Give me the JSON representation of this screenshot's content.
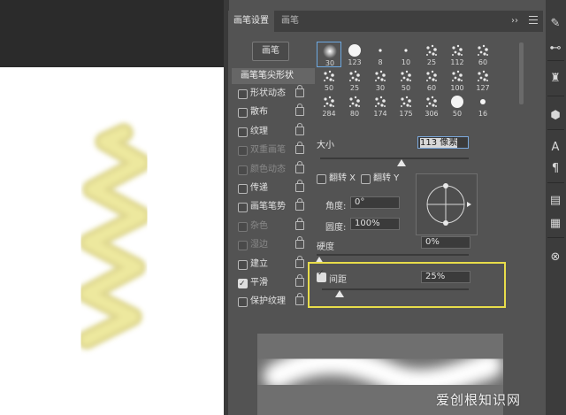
{
  "panel": {
    "tabs": [
      "画笔设置",
      "画笔"
    ],
    "collapse_label": "››",
    "brushes_button": "画笔",
    "tip_shape_label": "画笔笔尖形状",
    "options": [
      {
        "label": "形状动态",
        "checked": false,
        "disabled": false
      },
      {
        "label": "散布",
        "checked": false,
        "disabled": false
      },
      {
        "label": "纹理",
        "checked": false,
        "disabled": false
      },
      {
        "label": "双重画笔",
        "checked": false,
        "disabled": true
      },
      {
        "label": "颜色动态",
        "checked": false,
        "disabled": true
      },
      {
        "label": "传递",
        "checked": false,
        "disabled": false
      },
      {
        "label": "画笔笔势",
        "checked": false,
        "disabled": false
      },
      {
        "label": "杂色",
        "checked": false,
        "disabled": true
      },
      {
        "label": "湿边",
        "checked": false,
        "disabled": true
      },
      {
        "label": "建立",
        "checked": false,
        "disabled": false
      },
      {
        "label": "平滑",
        "checked": true,
        "disabled": false
      },
      {
        "label": "保护纹理",
        "checked": false,
        "disabled": false
      }
    ]
  },
  "brush_presets": [
    "30",
    "123",
    "8",
    "10",
    "25",
    "112",
    "60",
    "50",
    "25",
    "30",
    "50",
    "60",
    "100",
    "127",
    "284",
    "80",
    "174",
    "175",
    "306",
    "50",
    "16"
  ],
  "settings": {
    "size_label": "大小",
    "size_value": "113 像素",
    "flip_x": "翻转 X",
    "flip_y": "翻转 Y",
    "angle_label": "角度:",
    "angle_value": "0°",
    "roundness_label": "圆度:",
    "roundness_value": "100%",
    "hardness_label": "硬度",
    "hardness_value": "0%",
    "spacing_label": "间距",
    "spacing_value": "25%"
  },
  "levels": {
    "size": 0.55,
    "hardness": 0.0,
    "spacing": 0.12
  },
  "colors": {
    "highlight": "#e8dd4a",
    "stroke": "#e6e08a",
    "selection": "#6da8e0"
  },
  "watermark": "爱创根知识网"
}
